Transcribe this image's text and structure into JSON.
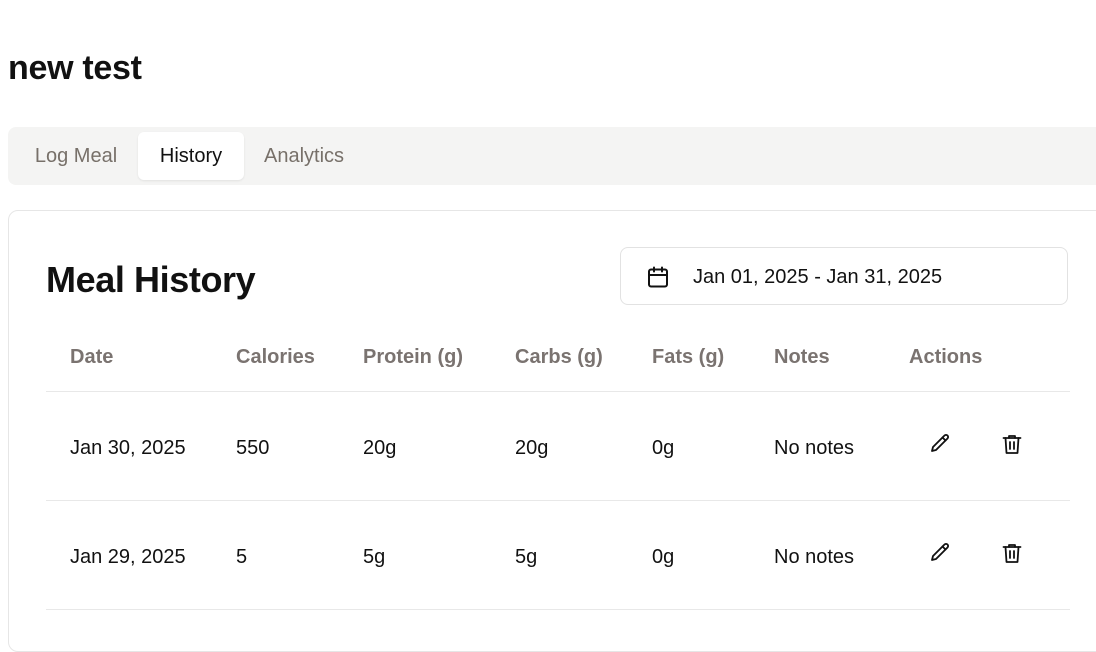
{
  "page": {
    "title": "new test"
  },
  "tabs": [
    {
      "label": "Log Meal"
    },
    {
      "label": "History"
    },
    {
      "label": "Analytics"
    }
  ],
  "history": {
    "title": "Meal History",
    "date_range": {
      "icon": "calendar-icon",
      "label": "Jan 01, 2025 - Jan 31, 2025"
    },
    "columns": [
      "Date",
      "Calories",
      "Protein (g)",
      "Carbs (g)",
      "Fats (g)",
      "Notes",
      "Actions"
    ],
    "rows": [
      {
        "date": "Jan 30, 2025",
        "calories": "550",
        "protein": "20g",
        "carbs": "20g",
        "fats": "0g",
        "notes": "No notes",
        "actions": [
          "pencil-icon",
          "trash-icon"
        ]
      },
      {
        "date": "Jan 29, 2025",
        "calories": "5",
        "protein": "5g",
        "carbs": "5g",
        "fats": "0g",
        "notes": "No notes",
        "actions": [
          "pencil-icon",
          "trash-icon"
        ]
      }
    ]
  }
}
